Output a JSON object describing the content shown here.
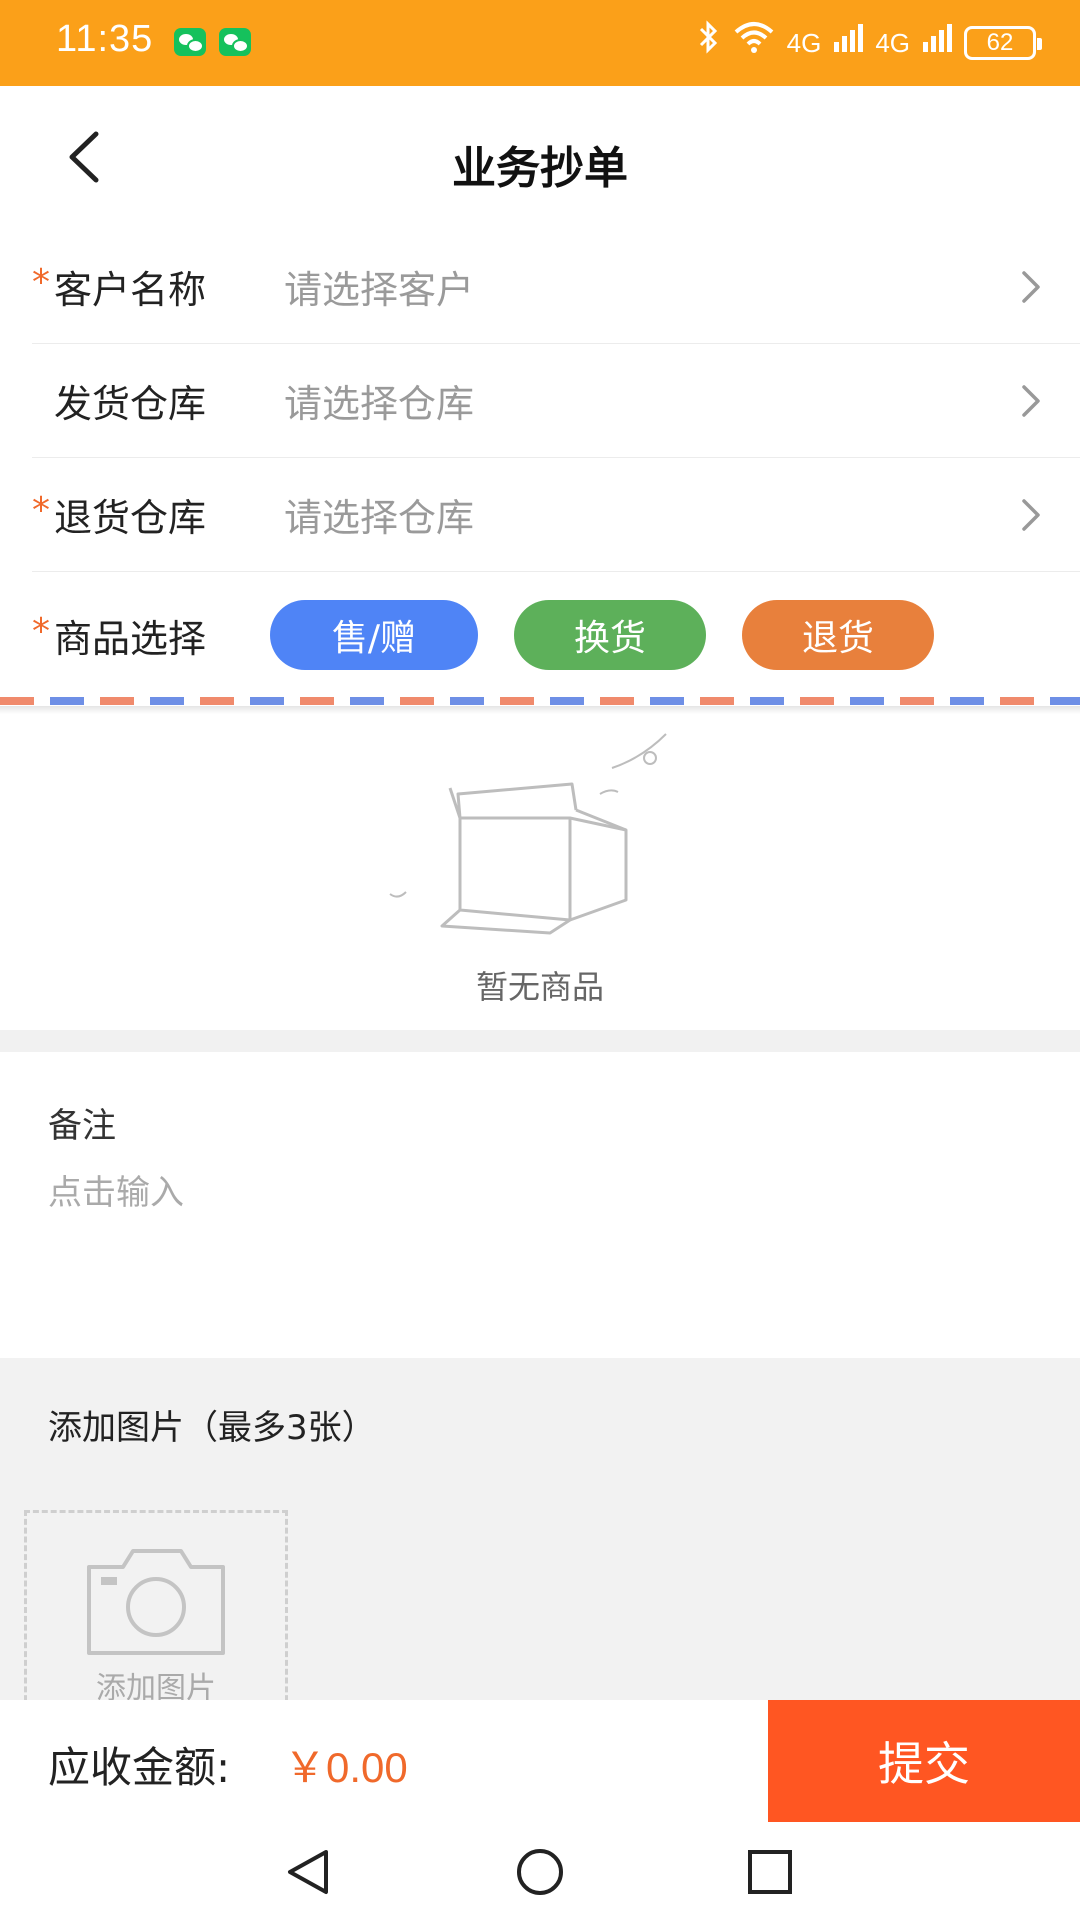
{
  "status_bar": {
    "time": "11:35",
    "network_1": "4G",
    "network_2": "4G",
    "battery": "62"
  },
  "header": {
    "title": "业务抄单",
    "back_icon": "chevron-left-icon"
  },
  "form": {
    "customer": {
      "label": "客户名称",
      "placeholder": "请选择客户",
      "required": true
    },
    "ship_warehouse": {
      "label": "发货仓库",
      "placeholder": "请选择仓库",
      "required": false
    },
    "return_warehouse": {
      "label": "退货仓库",
      "placeholder": "请选择仓库",
      "required": true
    },
    "goods": {
      "label": "商品选择",
      "required": true,
      "buttons": [
        {
          "label": "售/赠",
          "color": "#4F84F6"
        },
        {
          "label": "换货",
          "color": "#5DB05A"
        },
        {
          "label": "退货",
          "color": "#E8803C"
        }
      ]
    },
    "required_mark": "*"
  },
  "empty_state": {
    "text": "暂无商品",
    "icon": "empty-box-icon"
  },
  "remark": {
    "label": "备注",
    "placeholder": "点击输入"
  },
  "photos": {
    "title": "添加图片（最多3张）",
    "add_label": "添加图片",
    "icon": "camera-icon"
  },
  "footer": {
    "amount_label": "应收金额:",
    "amount_value": "￥0.00",
    "submit_label": "提交"
  },
  "colors": {
    "status_bar": "#FBA019",
    "accent": "#FF5622",
    "price": "#F0692B"
  }
}
